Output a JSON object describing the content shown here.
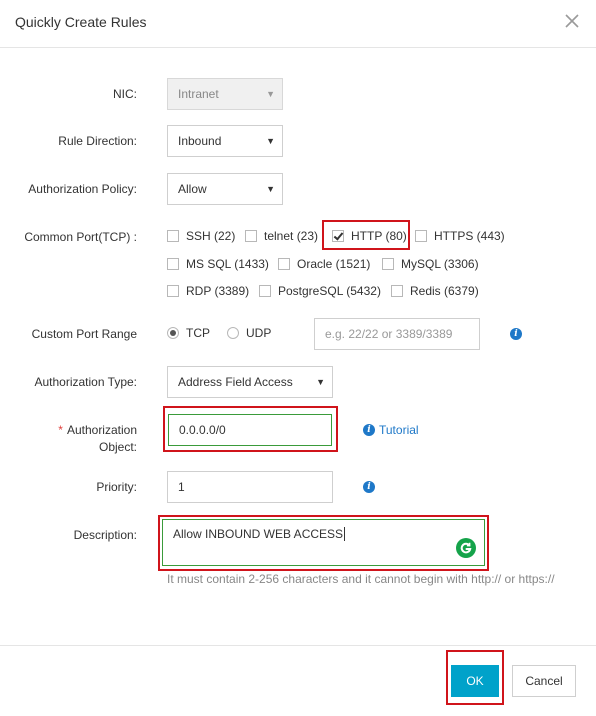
{
  "dialog": {
    "title": "Quickly Create Rules"
  },
  "form": {
    "nic": {
      "label": "NIC:",
      "value": "Intranet"
    },
    "rule_direction": {
      "label": "Rule Direction:",
      "value": "Inbound"
    },
    "authorization_policy": {
      "label": "Authorization Policy:",
      "value": "Allow"
    },
    "common_port": {
      "label": "Common Port(TCP) :",
      "options": [
        {
          "label": "SSH (22)",
          "checked": false
        },
        {
          "label": "telnet (23)",
          "checked": false
        },
        {
          "label": "HTTP (80)",
          "checked": true
        },
        {
          "label": "HTTPS (443)",
          "checked": false
        },
        {
          "label": "MS SQL (1433)",
          "checked": false
        },
        {
          "label": "Oracle (1521)",
          "checked": false
        },
        {
          "label": "MySQL (3306)",
          "checked": false
        },
        {
          "label": "RDP (3389)",
          "checked": false
        },
        {
          "label": "PostgreSQL (5432)",
          "checked": false
        },
        {
          "label": "Redis (6379)",
          "checked": false
        }
      ]
    },
    "custom_port_range": {
      "label": "Custom Port Range",
      "protocols": [
        {
          "label": "TCP",
          "selected": true
        },
        {
          "label": "UDP",
          "selected": false
        }
      ],
      "placeholder": "e.g. 22/22 or 3389/3389",
      "value": ""
    },
    "authorization_type": {
      "label": "Authorization Type:",
      "value": "Address Field Access"
    },
    "authorization_object": {
      "required_mark": "*",
      "label_line1": "Authorization",
      "label_line2": "Object:",
      "value": "0.0.0.0/0",
      "link": "Tutorial"
    },
    "priority": {
      "label": "Priority:",
      "value": "1"
    },
    "description": {
      "label": "Description:",
      "value": "Allow INBOUND WEB ACCESS",
      "hint": "It must contain 2-256 characters and it cannot begin with http:// or https://"
    }
  },
  "footer": {
    "ok_label": "OK",
    "cancel_label": "Cancel"
  },
  "colors": {
    "primary_button": "#00a2ca",
    "highlight_box": "#d0141b",
    "focus_border": "#3a9b3a",
    "link": "#1e78c8",
    "grammarly": "#15a34a"
  }
}
